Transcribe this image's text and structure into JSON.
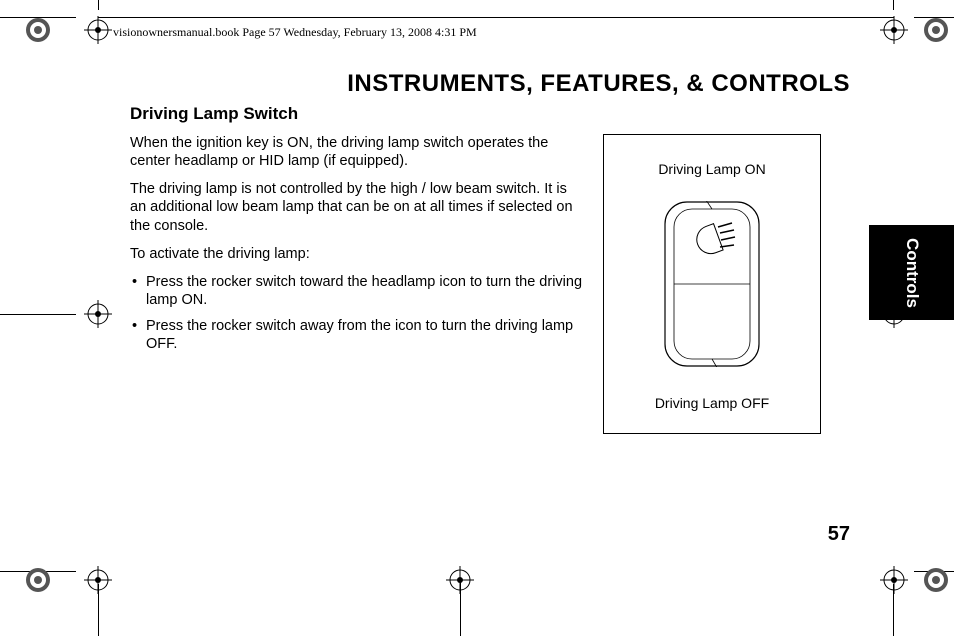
{
  "header_line": "visionownersmanual.book  Page 57  Wednesday, February 13, 2008  4:31 PM",
  "chapter_title": "INSTRUMENTS, FEATURES, & CONTROLS",
  "section_title": "Driving Lamp Switch",
  "paragraphs": {
    "p1": "When the ignition key is ON, the driving lamp switch operates the center headlamp or HID lamp (if equipped).",
    "p2": "The driving lamp is not controlled by the high / low beam switch. It is an additional low beam lamp that can be on at all times if selected on the console.",
    "p3": "To activate the driving lamp:"
  },
  "bullets": {
    "b1": "Press the rocker switch toward the headlamp icon to turn the driving lamp ON.",
    "b2": "Press the rocker switch away from the icon to turn the driving lamp OFF."
  },
  "figure": {
    "label_on": "Driving Lamp ON",
    "label_off": "Driving Lamp OFF"
  },
  "side_tab": "Controls",
  "page_number": "57"
}
